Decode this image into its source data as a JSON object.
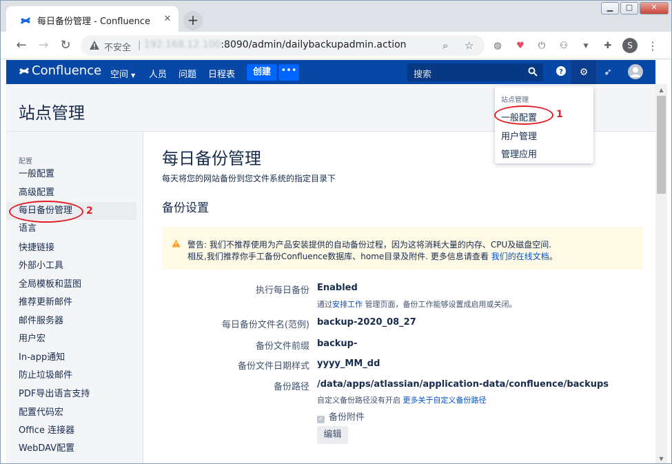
{
  "browser": {
    "tab_title": "每日备份管理 - Confluence",
    "tab_close": "✕",
    "new_tab": "+",
    "security_label": "不安全",
    "url_host": "192.168.12.100",
    "url_path": ":8090/admin/dailybackupadmin.action",
    "window_minimize": "▁",
    "window_maximize": "□",
    "window_close": "✕",
    "profile_initial": "S"
  },
  "header": {
    "brand": "Confluence",
    "nav": [
      "空间",
      "人员",
      "问题",
      "日程表"
    ],
    "create": "创建",
    "more": "•••",
    "search_placeholder": "搜索"
  },
  "page": {
    "title": "站点管理"
  },
  "sidebar": {
    "heading": "配置",
    "items": [
      "一般配置",
      "高级配置",
      "每日备份管理",
      "语言",
      "快捷链接",
      "外部小工具",
      "全局模板和蓝图",
      "推荐更新邮件",
      "邮件服务器",
      "用户宏",
      "In-app通知",
      "防止垃圾邮件",
      "PDF导出语言支持",
      "配置代码宏",
      "Office 连接器",
      "WebDAV配置"
    ]
  },
  "main": {
    "title": "每日备份管理",
    "description": "每天将您的网站备份到您文件系统的指定目录下",
    "section_title": "备份设置",
    "warning_line1": "警告: 我们不推荐使用为产品安装提供的自动备份过程，因为这将消耗大量的内存、CPU及磁盘空间.",
    "warning_line2_prefix": "相反,我们推荐你手工备份Confluence数据库、home目录及附件. 更多信息请查看 ",
    "warning_link": "我们的在线文档",
    "warning_suffix": "。",
    "rows": [
      {
        "label": "执行每日备份",
        "value": "Enabled"
      },
      {
        "label": "每日备份文件名(范例)",
        "value": "backup-2020_08_27"
      },
      {
        "label": "备份文件前缀",
        "value": "backup-"
      },
      {
        "label": "备份文件日期样式",
        "value": "yyyy_MM_dd"
      },
      {
        "label": "备份路径",
        "value": "/data/apps/atlassian/application-data/confluence/backups"
      }
    ],
    "hint1_prefix": "通过",
    "hint1_link": "安排工作",
    "hint1_suffix": " 管理页面，备份工作能够设置成启用或关闭。",
    "hint2_prefix": "自定义备份路径没有开启 ",
    "hint2_link": "更多关于自定义备份路径",
    "checkbox_label": "备份附件",
    "checkbox_checked": true,
    "edit_button": "编辑"
  },
  "dropdown": {
    "heading": "站点管理",
    "items": [
      "一般配置",
      "用户管理",
      "管理应用"
    ]
  },
  "annotations": {
    "marker1": "1",
    "marker2": "2",
    "color": "#e31b23"
  },
  "colors": {
    "header_bg": "#0747a6",
    "create_btn": "#0065ff",
    "link": "#0052cc",
    "warning_bg": "#fffae6",
    "warning_icon": "#ff991f"
  }
}
